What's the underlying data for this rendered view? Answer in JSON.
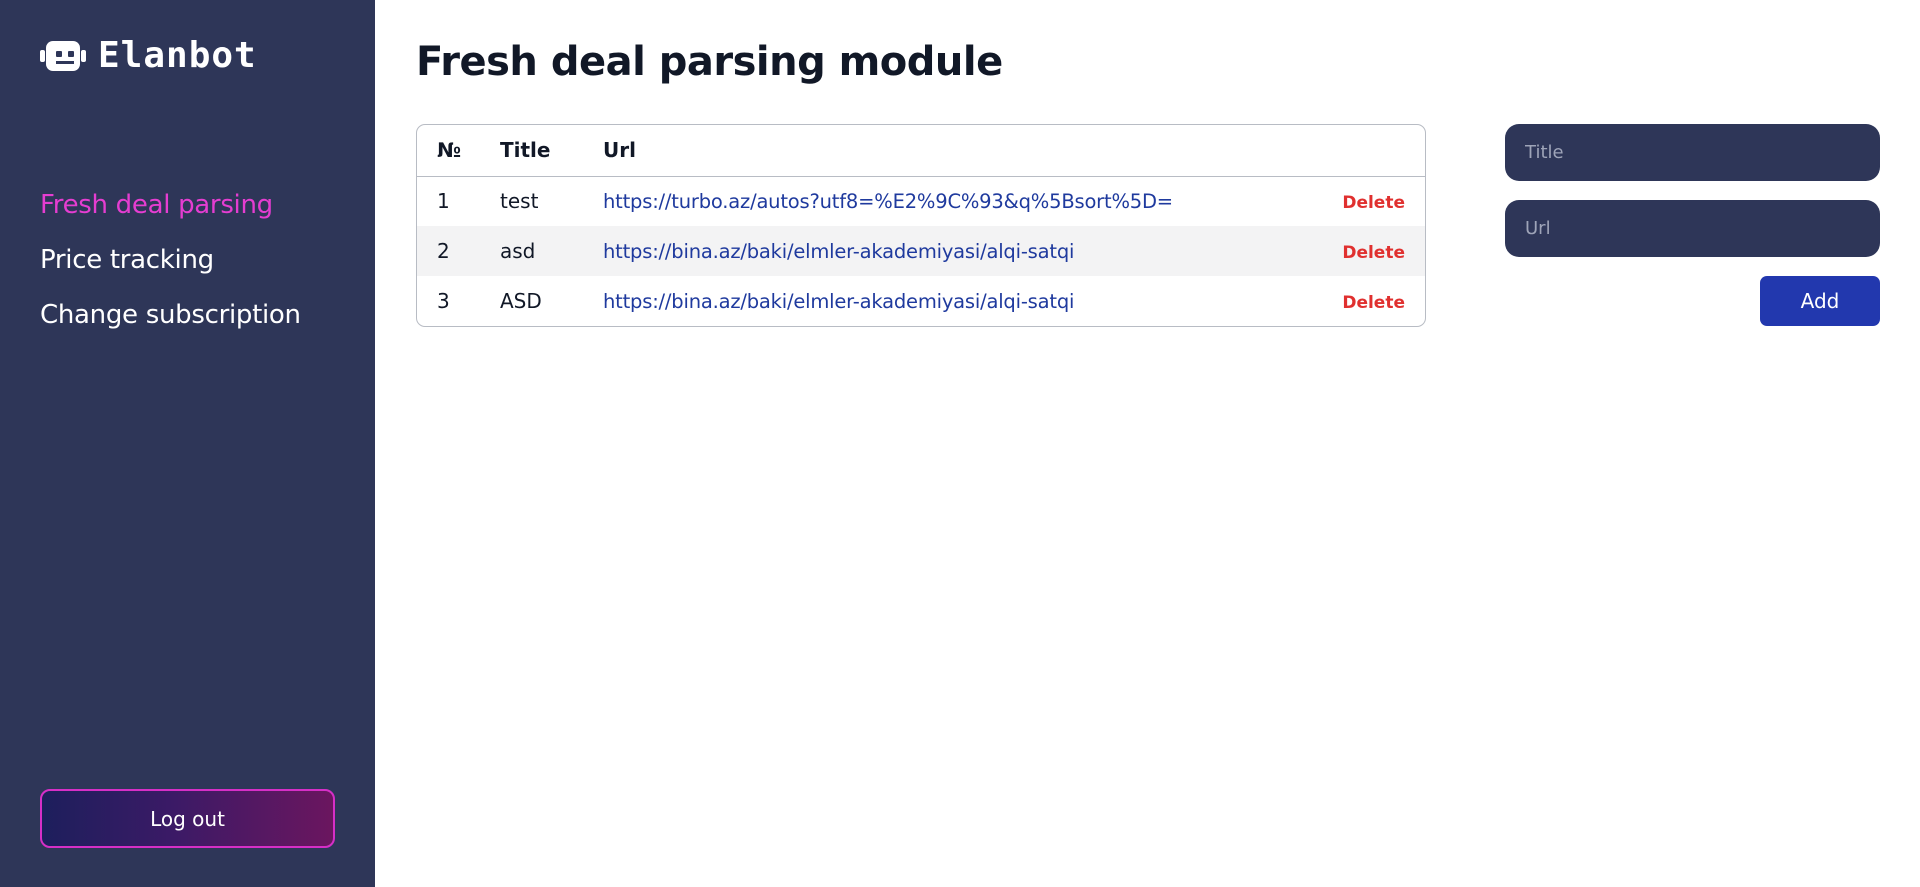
{
  "app": {
    "brand": "Elanbot"
  },
  "sidebar": {
    "items": [
      {
        "label": "Fresh deal parsing",
        "active": true
      },
      {
        "label": "Price tracking",
        "active": false
      },
      {
        "label": "Change subscription",
        "active": false
      }
    ],
    "logout_label": "Log out"
  },
  "page": {
    "title": "Fresh deal parsing module"
  },
  "table": {
    "headers": {
      "num": "№",
      "title": "Title",
      "url": "Url"
    },
    "rows": [
      {
        "num": "1",
        "title": "test",
        "url": "https://turbo.az/autos?utf8=%E2%9C%93&q%5Bsort%5D=",
        "action": "Delete"
      },
      {
        "num": "2",
        "title": "asd",
        "url": "https://bina.az/baki/elmler-akademiyasi/alqi-satqi",
        "action": "Delete"
      },
      {
        "num": "3",
        "title": "ASD",
        "url": "https://bina.az/baki/elmler-akademiyasi/alqi-satqi",
        "action": "Delete"
      }
    ]
  },
  "form": {
    "title_placeholder": "Title",
    "title_value": "",
    "url_placeholder": "Url",
    "url_value": "",
    "add_label": "Add"
  },
  "colors": {
    "sidebar_bg": "#2e3658",
    "active_nav": "#e53dd1",
    "link": "#1f3a9e",
    "delete": "#e0302f",
    "add_button": "#2238ae"
  },
  "icons": {
    "logo": "robot-icon"
  }
}
